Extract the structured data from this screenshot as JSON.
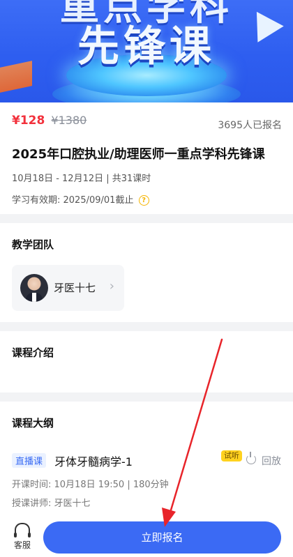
{
  "banner": {
    "title_top": "重点学科",
    "title_main": "先锋课"
  },
  "course": {
    "price": "¥128",
    "original_price": "¥1380",
    "enrolled": "3695人已报名",
    "title": "2025年口腔执业/助理医师一重点学科先锋课",
    "schedule": "10月18日 - 12月12日 | 共31课时",
    "validity": "学习有效期: 2025/09/01截止",
    "help_icon": "?"
  },
  "team": {
    "section_title": "教学团队",
    "teacher_name": "牙医十七",
    "chevron": "›"
  },
  "intro": {
    "section_title": "课程介绍"
  },
  "outline": {
    "section_title": "课程大纲",
    "lesson": {
      "tag": "直播课",
      "name": "牙体牙髓病学-1",
      "trial_tag": "试听",
      "replay_label": "回放",
      "time": "开课时间: 10月18日 19:50 | 180分钟",
      "teacher": "授课讲师: 牙医十七"
    }
  },
  "bottom_bar": {
    "service_label": "客服",
    "cta_label": "立即报名"
  },
  "colors": {
    "accent": "#3b6af4",
    "price_red": "#f2313c",
    "trial_yellow": "#ffd21f",
    "annotation_red": "#e8242a"
  }
}
